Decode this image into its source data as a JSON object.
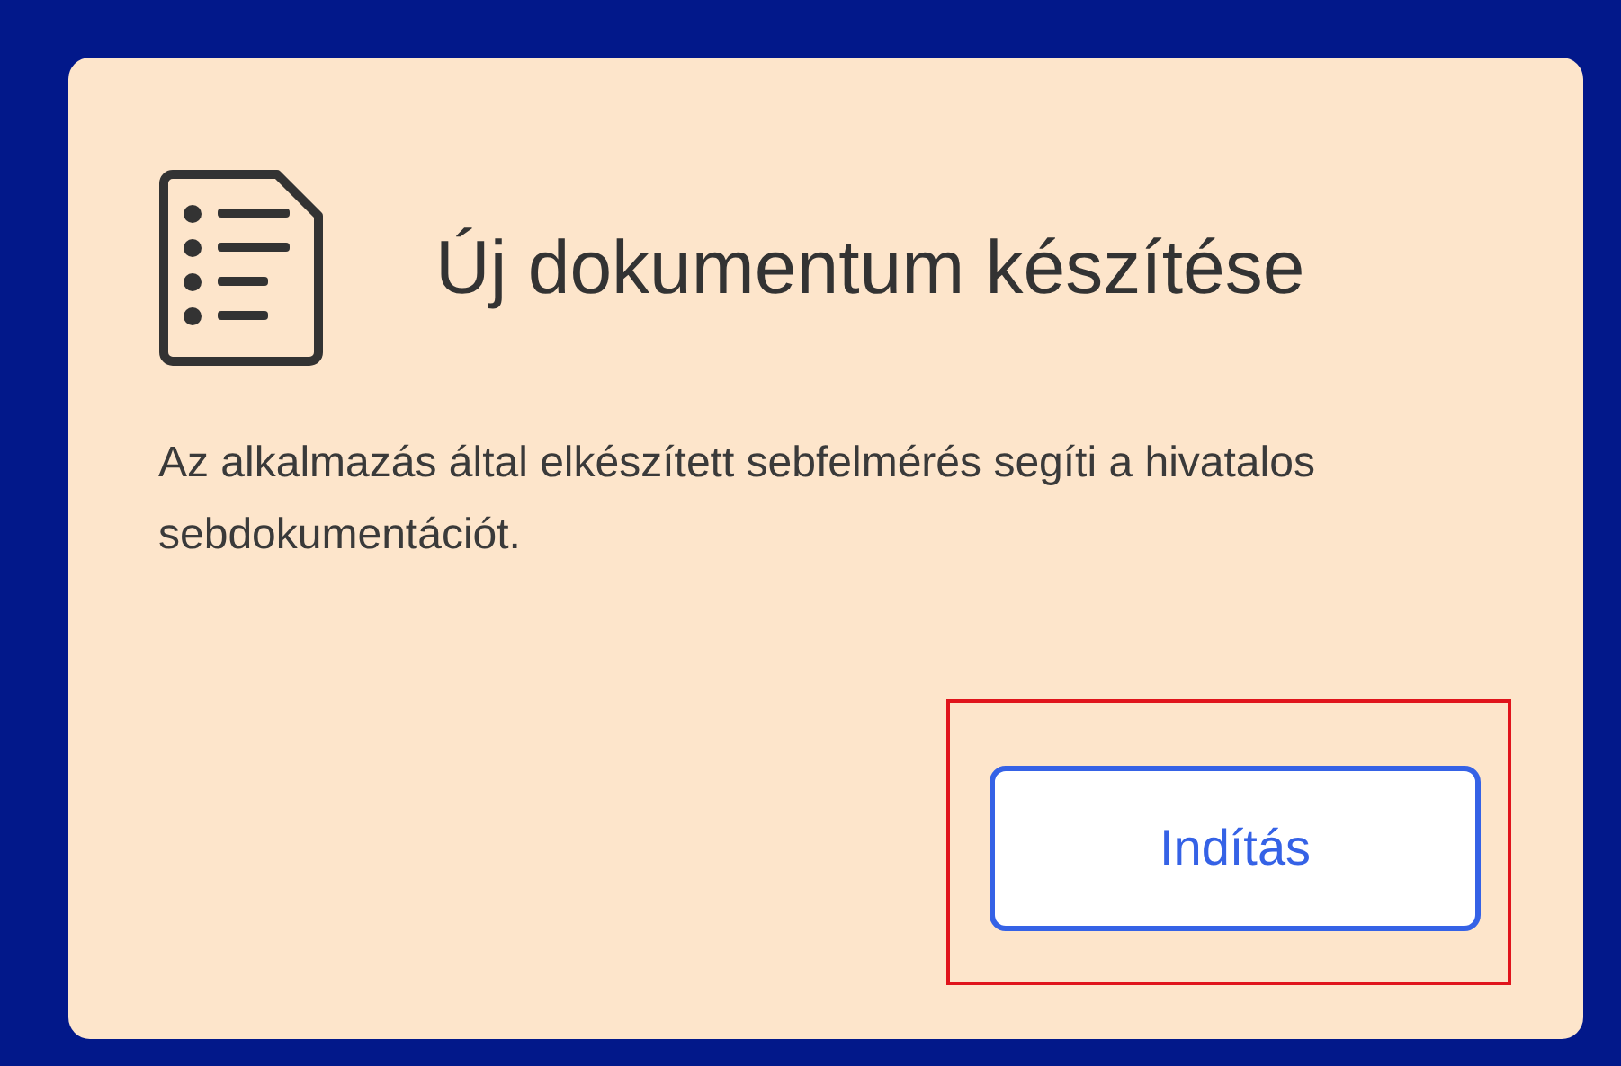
{
  "card": {
    "title": "Új dokumentum készítése",
    "description": "Az alkalmazás által elkészített sebfelmérés segíti a hivatalos sebdokumentációt.",
    "button": {
      "label": "Indítás",
      "highlighted": true
    }
  }
}
